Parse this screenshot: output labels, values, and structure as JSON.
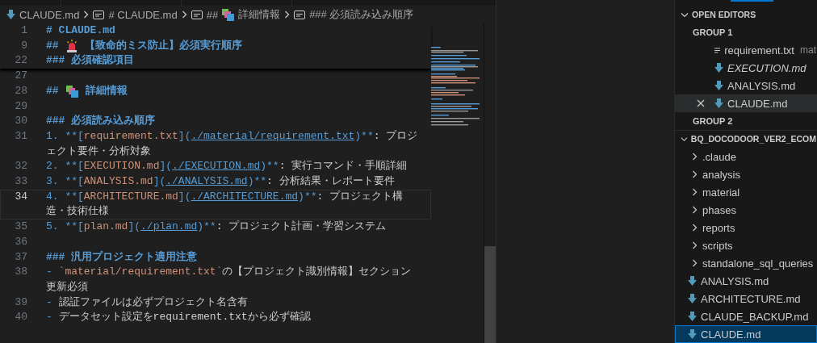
{
  "breadcrumb": [
    {
      "kind": "file",
      "label": "CLAUDE.md"
    },
    {
      "kind": "heading",
      "label": "# CLAUDE.md"
    },
    {
      "kind": "heading-emoji",
      "marker": "##",
      "label": "詳細情報"
    },
    {
      "kind": "heading",
      "label": "### 必須読み込み順序"
    }
  ],
  "editor": {
    "sticky_lines": [
      {
        "number": "1",
        "current": false,
        "segments": [
          {
            "kind": "h",
            "t": "# CLAUDE.md"
          }
        ]
      },
      {
        "number": "9",
        "current": false,
        "segments": [
          {
            "kind": "h",
            "t": "##"
          },
          {
            "kind": "emoji-siren"
          },
          {
            "kind": "h",
            "t": "【致命的ミス防止】必須実行順序"
          }
        ]
      },
      {
        "number": "22",
        "current": false,
        "segments": [
          {
            "kind": "h",
            "t": "### 必須確認項目"
          }
        ]
      }
    ],
    "lines": [
      {
        "number": "27",
        "current": false
      },
      {
        "number": "28",
        "current": false,
        "segments": [
          {
            "kind": "h",
            "t": "##"
          },
          {
            "kind": "emoji-squares"
          },
          {
            "kind": "h",
            "t": "詳細情報"
          }
        ]
      },
      {
        "number": "29",
        "current": false
      },
      {
        "number": "30",
        "current": false,
        "segments": [
          {
            "kind": "h",
            "t": "### 必須読み込み順序"
          }
        ]
      },
      {
        "number": "31",
        "current": false,
        "segments": [
          {
            "kind": "p",
            "t": "1. **["
          },
          {
            "kind": "lt",
            "t": "requirement.txt"
          },
          {
            "kind": "p",
            "t": "]("
          },
          {
            "kind": "url",
            "t": "./material/requirement.txt"
          },
          {
            "kind": "p",
            "t": ")**"
          },
          {
            "kind": "t",
            "t": ": プロジェクト要件・分析対象"
          }
        ]
      },
      {
        "number": "32",
        "current": false,
        "segments": [
          {
            "kind": "p",
            "t": "2. **["
          },
          {
            "kind": "lt",
            "t": "EXECUTION.md"
          },
          {
            "kind": "p",
            "t": "]("
          },
          {
            "kind": "url",
            "t": "./EXECUTION.md"
          },
          {
            "kind": "p",
            "t": ")**"
          },
          {
            "kind": "t",
            "t": ": 実行コマンド・手順詳細"
          }
        ]
      },
      {
        "number": "33",
        "current": false,
        "segments": [
          {
            "kind": "p",
            "t": "3. **["
          },
          {
            "kind": "lt",
            "t": "ANALYSIS.md"
          },
          {
            "kind": "p",
            "t": "]("
          },
          {
            "kind": "url",
            "t": "./ANALYSIS.md"
          },
          {
            "kind": "p",
            "t": ")**"
          },
          {
            "kind": "t",
            "t": ": 分析結果・レポート要件"
          }
        ]
      },
      {
        "number": "34",
        "current": true,
        "segments": [
          {
            "kind": "p",
            "t": "4. **["
          },
          {
            "kind": "lt",
            "t": "ARCHITECTURE.md"
          },
          {
            "kind": "p",
            "t": "]("
          },
          {
            "kind": "url",
            "t": "./ARCHITECTURE.md"
          },
          {
            "kind": "p",
            "t": ")**"
          },
          {
            "kind": "t",
            "t": ": プロジェクト構造・技術仕様"
          }
        ]
      },
      {
        "number": "35",
        "current": false,
        "segments": [
          {
            "kind": "p",
            "t": "5. **["
          },
          {
            "kind": "lt",
            "t": "plan.md"
          },
          {
            "kind": "p",
            "t": "]("
          },
          {
            "kind": "url",
            "t": "./plan.md"
          },
          {
            "kind": "p",
            "t": ")**"
          },
          {
            "kind": "t",
            "t": ": プロジェクト計画・学習システム"
          }
        ]
      },
      {
        "number": "36",
        "current": false
      },
      {
        "number": "37",
        "current": false,
        "segments": [
          {
            "kind": "h",
            "t": "### 汎用プロジェクト適用注意"
          }
        ]
      },
      {
        "number": "38",
        "current": false,
        "segments": [
          {
            "kind": "p",
            "t": "- "
          },
          {
            "kind": "code",
            "t": "`material/requirement.txt`"
          },
          {
            "kind": "t",
            "t": "の【プロジェクト識別情報】セクション更新必須"
          }
        ]
      },
      {
        "number": "39",
        "current": false,
        "segments": [
          {
            "kind": "p",
            "t": "- "
          },
          {
            "kind": "t",
            "t": "認証ファイルは必ずプロジェクト名含有"
          }
        ]
      },
      {
        "number": "40",
        "current": false,
        "segments": [
          {
            "kind": "p",
            "t": "- "
          },
          {
            "kind": "t",
            "t": "データセット設定をrequirement.txtから必ず確認"
          }
        ]
      }
    ]
  },
  "sidebar": {
    "open_editors": {
      "title": "OPEN EDITORS",
      "expanded": true,
      "groups": [
        {
          "title": "GROUP 1",
          "items": [
            {
              "name": "requirement.txt",
              "description": "mat",
              "kind": "text",
              "preview": false,
              "hovered": false
            },
            {
              "name": "EXECUTION.md",
              "kind": "markdown",
              "preview": true,
              "hovered": false
            },
            {
              "name": "ANALYSIS.md",
              "kind": "markdown",
              "preview": false,
              "hovered": false
            },
            {
              "name": "CLAUDE.md",
              "kind": "markdown",
              "preview": false,
              "hovered": true
            }
          ]
        },
        {
          "title": "GROUP 2"
        }
      ]
    },
    "explorer": {
      "title": "BQ_DOCODOOR_VER2_ECOM",
      "expanded": true,
      "items": [
        {
          "name": ".claude",
          "kind": "folder",
          "expanded": false,
          "selected": false
        },
        {
          "name": "analysis",
          "kind": "folder",
          "expanded": false,
          "selected": false
        },
        {
          "name": "material",
          "kind": "folder",
          "expanded": false,
          "selected": false
        },
        {
          "name": "phases",
          "kind": "folder",
          "expanded": false,
          "selected": false
        },
        {
          "name": "reports",
          "kind": "folder",
          "expanded": false,
          "selected": false
        },
        {
          "name": "scripts",
          "kind": "folder",
          "expanded": false,
          "selected": false
        },
        {
          "name": "standalone_sql_queries",
          "kind": "folder",
          "expanded": false,
          "selected": false
        },
        {
          "name": "ANALYSIS.md",
          "kind": "markdown",
          "selected": false
        },
        {
          "name": "ARCHITECTURE.md",
          "kind": "markdown",
          "selected": false
        },
        {
          "name": "CLAUDE_BACKUP.md",
          "kind": "markdown",
          "selected": false
        },
        {
          "name": "CLAUDE.md",
          "kind": "markdown",
          "selected": true
        }
      ]
    }
  }
}
